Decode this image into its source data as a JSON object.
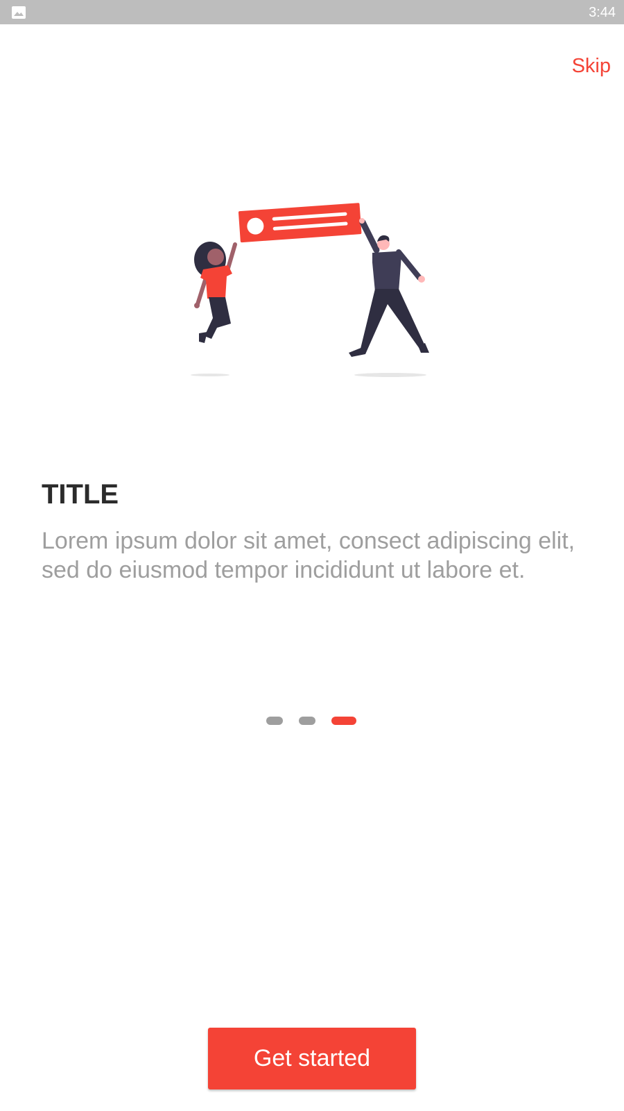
{
  "status_bar": {
    "time": "3:44",
    "left_icon": "image-icon"
  },
  "header": {
    "skip_label": "Skip"
  },
  "illustration": {
    "name": "people-holding-banner-illustration"
  },
  "content": {
    "title": "TITLE",
    "description": "Lorem ipsum dolor sit amet, consect adipiscing elit, sed do eiusmod tempor incididunt ut labore et."
  },
  "page_indicator": {
    "total": 3,
    "active_index": 2
  },
  "footer": {
    "get_started_label": "Get started"
  },
  "colors": {
    "accent": "#f44336",
    "status_bar": "#bdbdbd",
    "title_text": "#2b2b2b",
    "body_text": "#9e9e9e",
    "inactive_dot": "#9e9e9e",
    "figure_dark": "#3f3d56",
    "figure_darker": "#2f2e41",
    "skin_dark": "#a0616a",
    "skin_light": "#ffb8b8"
  }
}
